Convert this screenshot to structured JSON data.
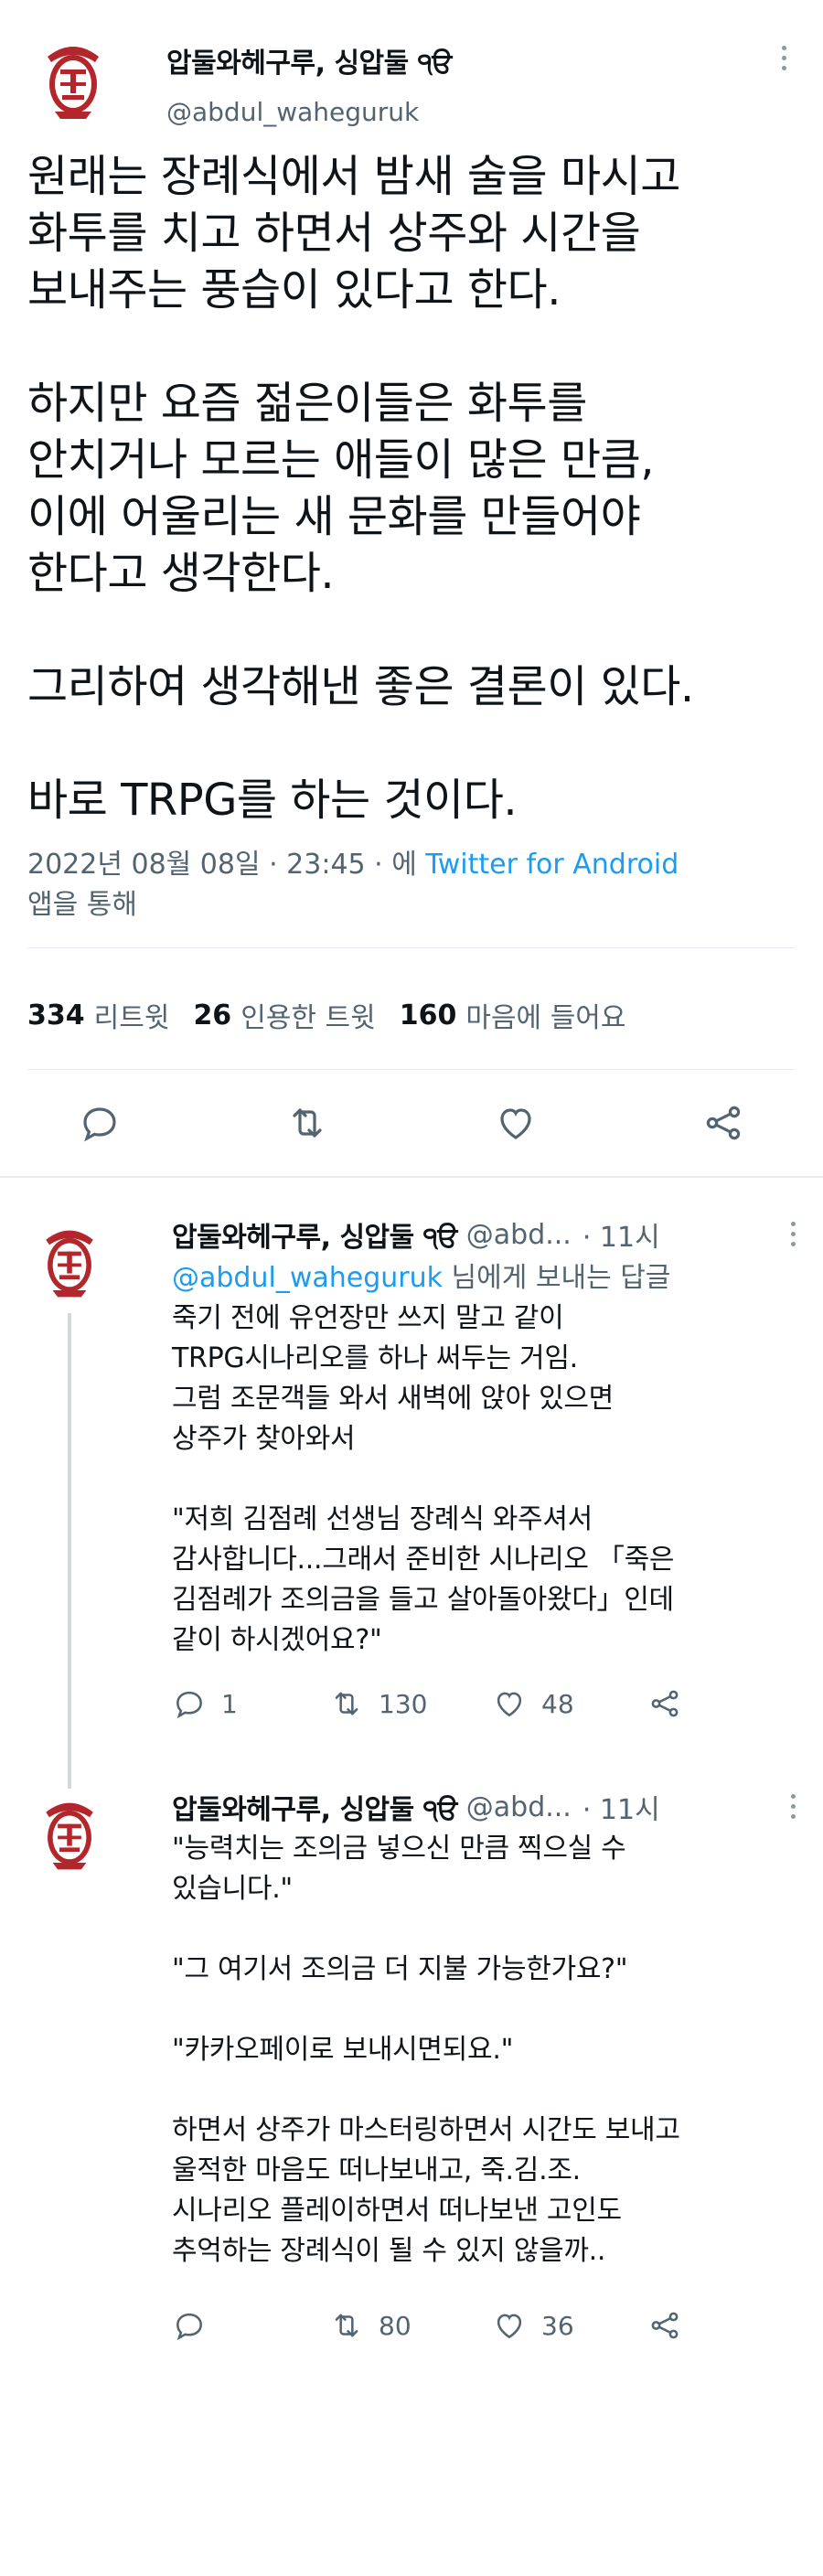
{
  "main_tweet": {
    "display_name": "압둘와헤구루, 싱압둘 ੧ੳ",
    "handle": "@abdul_waheguruk",
    "paragraphs": [
      [
        "원래는 장례식에서 밤새 술을 마시고",
        "화투를 치고 하면서 상주와 시간을",
        "보내주는 풍습이 있다고 한다."
      ],
      [
        "하지만 요즘 젊은이들은 화투를",
        "안치거나 모르는 애들이 많은 만큼,",
        "이에 어울리는 새 문화를 만들어야",
        "한다고 생각한다."
      ],
      [
        "그리하여 생각해낸 좋은 결론이 있다."
      ],
      [
        "바로 TRPG를 하는 것이다."
      ]
    ],
    "timestamp": "2022년 08월 08일 · 23:45 · 에 ",
    "source": "Twitter for Android",
    "via": "앱을 통해",
    "retweets": "334",
    "retweets_label": "리트윗",
    "quotes": "26",
    "quotes_label": "인용한 트윗",
    "likes": "160",
    "likes_label": "마음에 들어요"
  },
  "replies": [
    {
      "display_name": "압둘와헤구루, 싱압둘 ੧ੳ",
      "handle": "@abd...",
      "time": "· 11시",
      "reply_to_handle": "@abdul_waheguruk",
      "reply_to_suffix": " 님에게 보내는 답글",
      "paragraphs": [
        [
          "죽기 전에 유언장만 쓰지 말고 같이",
          "TRPG시나리오를 하나 써두는 거임.",
          "그럼 조문객들 와서 새벽에 앉아 있으면",
          "상주가 찾아와서"
        ],
        [
          "\"저희 김점례 선생님 장례식 와주셔서",
          "감사합니다...그래서 준비한 시나리오 「죽은",
          "김점례가 조의금을 들고 살아돌아왔다」인데",
          "같이 하시겠어요?\""
        ]
      ],
      "replies_count": "1",
      "retweets_count": "130",
      "likes_count": "48"
    },
    {
      "display_name": "압둘와헤구루, 싱압둘 ੧ੳ",
      "handle": "@abd...",
      "time": "· 11시",
      "paragraphs": [
        [
          "\"능력치는 조의금 넣으신 만큼 찍으실 수",
          "있습니다.\""
        ],
        [
          "\"그 여기서 조의금 더 지불 가능한가요?\""
        ],
        [
          "\"카카오페이로 보내시면되요.\""
        ],
        [
          "하면서 상주가 마스터링하면서 시간도 보내고",
          "울적한 마음도 떠나보내고, 죽.김.조.",
          "시나리오 플레이하면서 떠나보낸 고인도",
          "추억하는 장례식이 될 수 있지 않을까.."
        ]
      ],
      "replies_count": "",
      "retweets_count": "80",
      "likes_count": "36"
    }
  ],
  "colors": {
    "text": "#0f1419",
    "secondary": "#536471",
    "link": "#1d9bf0",
    "avatar_red": "#b3262b"
  }
}
